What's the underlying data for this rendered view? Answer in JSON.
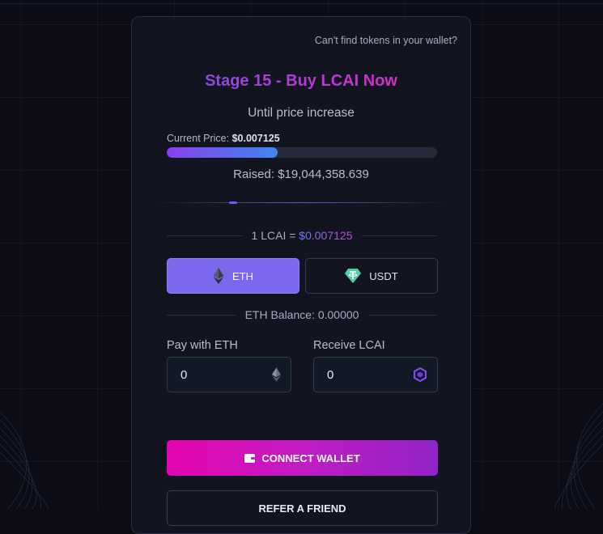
{
  "header": {
    "cant_find": "Can't find tokens in your wallet?"
  },
  "presale": {
    "title": "Stage 15 - Buy LCAI Now",
    "until": "Until price increase",
    "current_price_label": "Current Price:",
    "current_price_value": "$0.007125",
    "progress_fraction": 0.41,
    "raised": "Raised: $19,044,358.639"
  },
  "rate": {
    "prefix": "1 LCAI = ",
    "value": "$0.007125"
  },
  "tabs": [
    {
      "label": "ETH",
      "icon": "ethereum-icon",
      "active": true
    },
    {
      "label": "USDT",
      "icon": "tether-icon",
      "active": false
    }
  ],
  "balance": "ETH Balance: 0.00000",
  "pay": {
    "label": "Pay with ETH",
    "value": "0",
    "icon": "ethereum-icon"
  },
  "receive": {
    "label": "Receive LCAI",
    "value": "0",
    "icon": "lcai-token-icon"
  },
  "buttons": {
    "connect": "CONNECT WALLET",
    "connect_icon": "wallet-icon",
    "refer": "REFER A FRIEND"
  },
  "colors": {
    "accent_purple": "#7c68ec",
    "accent_magenta": "#e406b0",
    "background": "#0b0c16",
    "card": "#12141f"
  }
}
